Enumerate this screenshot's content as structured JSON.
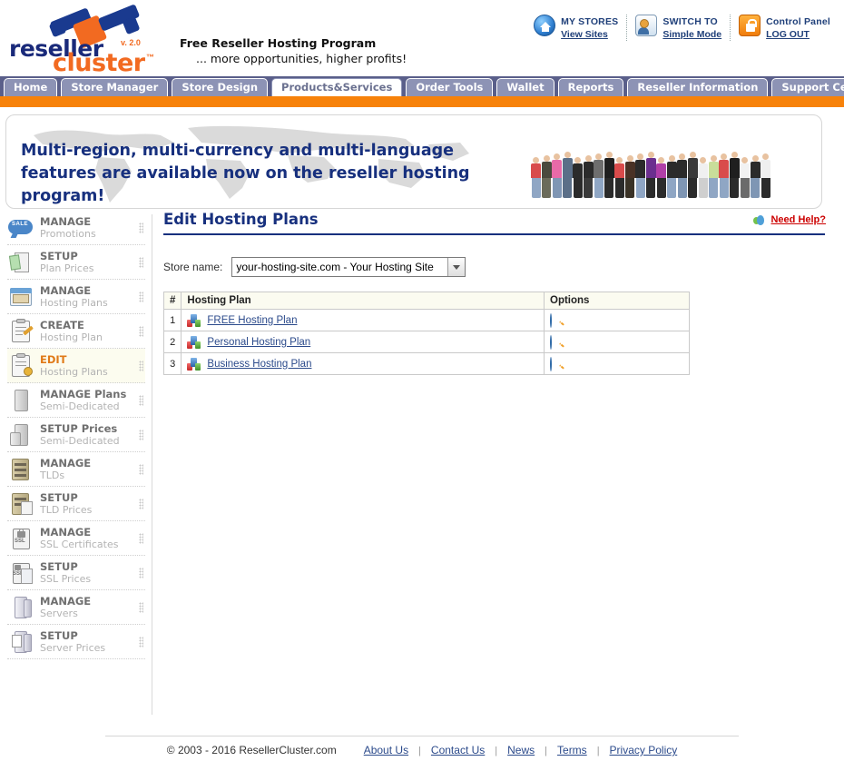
{
  "brand": {
    "logo_word1": "reseller",
    "logo_word2": "cluster",
    "logo_tm": "™",
    "logo_version": "v. 2.0",
    "tagline_line1": "Free Reseller Hosting Program",
    "tagline_line2": "... more opportunities, higher profits!",
    "accent_orange": "#f7820a",
    "accent_blue": "#17307e",
    "tab_purple": "#5a5f8a"
  },
  "header_links": [
    {
      "icon": "home-icon",
      "line1": "MY  STORES",
      "line2": "View Sites"
    },
    {
      "icon": "user-switch-icon",
      "line1": "SWITCH TO",
      "line2": "Simple Mode"
    },
    {
      "icon": "lock-icon",
      "line1": "Control Panel",
      "line2": "LOG OUT"
    }
  ],
  "nav_tabs": [
    {
      "label": "Home",
      "active": false
    },
    {
      "label": "Store Manager",
      "active": false
    },
    {
      "label": "Store Design",
      "active": false
    },
    {
      "label": "Products&Services",
      "active": true
    },
    {
      "label": "Order Tools",
      "active": false
    },
    {
      "label": "Wallet",
      "active": false
    },
    {
      "label": "Reports",
      "active": false
    },
    {
      "label": "Reseller Information",
      "active": false
    },
    {
      "label": "Support Center",
      "active": false
    }
  ],
  "banner": {
    "text": "Multi-region, multi-currency and multi-language features are available now on the reseller hosting program!"
  },
  "sidebar": {
    "items": [
      {
        "title": "MANAGE",
        "subtitle": "Promotions",
        "icon": "sale-tag-icon",
        "active": false
      },
      {
        "title": "SETUP",
        "subtitle": "Plan Prices",
        "icon": "price-list-icon",
        "active": false
      },
      {
        "title": "MANAGE",
        "subtitle": "Hosting Plans",
        "icon": "plan-box-icon",
        "active": false
      },
      {
        "title": "CREATE",
        "subtitle": "Hosting Plan",
        "icon": "clipboard-pen-icon",
        "active": false
      },
      {
        "title": "EDIT",
        "subtitle": "Hosting Plans",
        "icon": "clipboard-gear-icon",
        "active": true
      },
      {
        "title": "MANAGE Plans",
        "subtitle": "Semi-Dedicated",
        "icon": "server-icon",
        "active": false
      },
      {
        "title": "SETUP Prices",
        "subtitle": "Semi-Dedicated",
        "icon": "server-price-icon",
        "active": false
      },
      {
        "title": "MANAGE",
        "subtitle": "TLDs",
        "icon": "tld-cabinet-icon",
        "active": false
      },
      {
        "title": "SETUP",
        "subtitle": "TLD Prices",
        "icon": "tld-price-icon",
        "active": false
      },
      {
        "title": "MANAGE",
        "subtitle": "SSL Certificates",
        "icon": "ssl-lock-icon",
        "active": false
      },
      {
        "title": "SETUP",
        "subtitle": "SSL Prices",
        "icon": "ssl-price-icon",
        "active": false
      },
      {
        "title": "MANAGE",
        "subtitle": "Servers",
        "icon": "server-tower-icon",
        "active": false
      },
      {
        "title": "SETUP",
        "subtitle": "Server Prices",
        "icon": "server-calc-icon",
        "active": false
      }
    ]
  },
  "main": {
    "page_title": "Edit Hosting Plans",
    "need_help_label": "Need Help?",
    "need_help_icon": "help-buddy-icon",
    "store_label": "Store name:",
    "store_selected": "your-hosting-site.com - Your Hosting Site",
    "store_options": [
      "your-hosting-site.com - Your Hosting Site"
    ],
    "table": {
      "columns": [
        "#",
        "Hosting Plan",
        "Options"
      ],
      "rows": [
        {
          "num": "1",
          "plan": "FREE Hosting Plan",
          "option_icon": "search-globe-icon"
        },
        {
          "num": "2",
          "plan": "Personal Hosting Plan",
          "option_icon": "search-globe-icon"
        },
        {
          "num": "3",
          "plan": "Business Hosting Plan",
          "option_icon": "search-globe-icon"
        }
      ]
    }
  },
  "footer": {
    "copyright": "© 2003 - 2016 ResellerCluster.com",
    "links": [
      "About Us",
      "Contact Us",
      "News",
      "Terms",
      "Privacy Policy"
    ],
    "separator": "|"
  }
}
